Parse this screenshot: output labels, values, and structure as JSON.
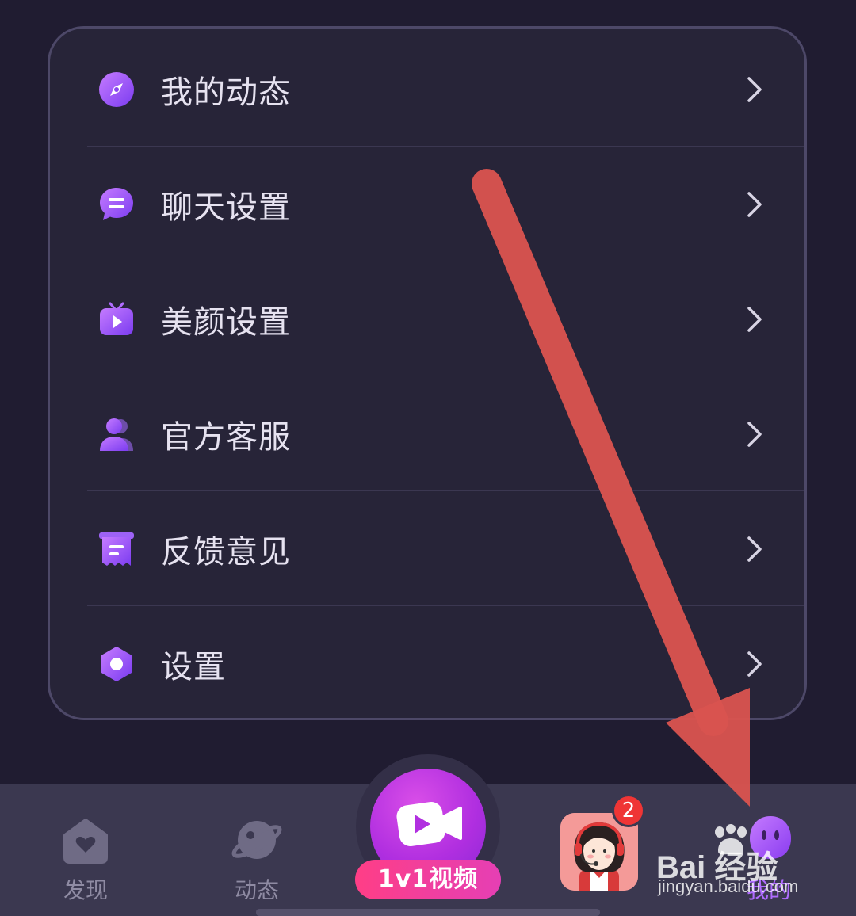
{
  "menu": {
    "items": [
      {
        "label": "我的动态",
        "icon": "compass-icon"
      },
      {
        "label": "聊天设置",
        "icon": "chat-bubble-icon"
      },
      {
        "label": "美颜设置",
        "icon": "tv-play-icon"
      },
      {
        "label": "官方客服",
        "icon": "person-icon"
      },
      {
        "label": "反馈意见",
        "icon": "feedback-icon"
      },
      {
        "label": "设置",
        "icon": "hexagon-settings-icon"
      }
    ]
  },
  "tabbar": {
    "discover_label": "发现",
    "moments_label": "动态",
    "video_label": "1v1视频",
    "mine_label": "我的",
    "message_badge": "2"
  },
  "watermark": {
    "brand": "Bai 经验",
    "url": "jingyan.baidu.com"
  },
  "colors": {
    "background": "#201c31",
    "card": "#272438",
    "accent_purple": "#a058f0",
    "arrow_red": "#d9534f",
    "badge_red": "#ef3535"
  }
}
